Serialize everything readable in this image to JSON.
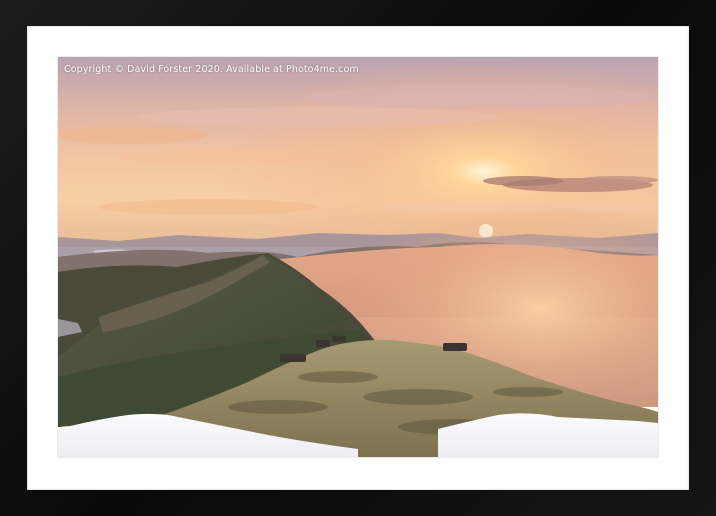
{
  "image": {
    "copyright_text": "Copyright  © David Forster  2020. Available at Photo4me.com"
  },
  "colors": {
    "frame": "#111111",
    "mount": "#ffffff",
    "sky_top": "#c9a6a8",
    "sky_glow": "#f7c79a",
    "sun": "#fff3d0",
    "mist": "#e6b08e",
    "ridge_dark": "#3c4432",
    "grass": "#8a7c55",
    "snow": "#f4f3f6"
  }
}
